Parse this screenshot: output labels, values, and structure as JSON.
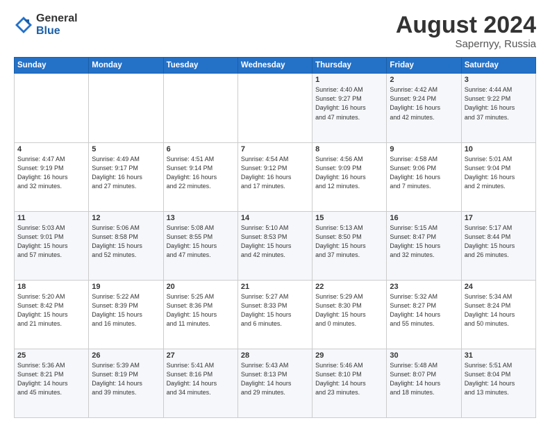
{
  "header": {
    "logo_general": "General",
    "logo_blue": "Blue",
    "title_month": "August 2024",
    "title_location": "Sapernyy, Russia"
  },
  "days_of_week": [
    "Sunday",
    "Monday",
    "Tuesday",
    "Wednesday",
    "Thursday",
    "Friday",
    "Saturday"
  ],
  "weeks": [
    [
      {
        "day": "",
        "info": ""
      },
      {
        "day": "",
        "info": ""
      },
      {
        "day": "",
        "info": ""
      },
      {
        "day": "",
        "info": ""
      },
      {
        "day": "1",
        "info": "Sunrise: 4:40 AM\nSunset: 9:27 PM\nDaylight: 16 hours\nand 47 minutes."
      },
      {
        "day": "2",
        "info": "Sunrise: 4:42 AM\nSunset: 9:24 PM\nDaylight: 16 hours\nand 42 minutes."
      },
      {
        "day": "3",
        "info": "Sunrise: 4:44 AM\nSunset: 9:22 PM\nDaylight: 16 hours\nand 37 minutes."
      }
    ],
    [
      {
        "day": "4",
        "info": "Sunrise: 4:47 AM\nSunset: 9:19 PM\nDaylight: 16 hours\nand 32 minutes."
      },
      {
        "day": "5",
        "info": "Sunrise: 4:49 AM\nSunset: 9:17 PM\nDaylight: 16 hours\nand 27 minutes."
      },
      {
        "day": "6",
        "info": "Sunrise: 4:51 AM\nSunset: 9:14 PM\nDaylight: 16 hours\nand 22 minutes."
      },
      {
        "day": "7",
        "info": "Sunrise: 4:54 AM\nSunset: 9:12 PM\nDaylight: 16 hours\nand 17 minutes."
      },
      {
        "day": "8",
        "info": "Sunrise: 4:56 AM\nSunset: 9:09 PM\nDaylight: 16 hours\nand 12 minutes."
      },
      {
        "day": "9",
        "info": "Sunrise: 4:58 AM\nSunset: 9:06 PM\nDaylight: 16 hours\nand 7 minutes."
      },
      {
        "day": "10",
        "info": "Sunrise: 5:01 AM\nSunset: 9:04 PM\nDaylight: 16 hours\nand 2 minutes."
      }
    ],
    [
      {
        "day": "11",
        "info": "Sunrise: 5:03 AM\nSunset: 9:01 PM\nDaylight: 15 hours\nand 57 minutes."
      },
      {
        "day": "12",
        "info": "Sunrise: 5:06 AM\nSunset: 8:58 PM\nDaylight: 15 hours\nand 52 minutes."
      },
      {
        "day": "13",
        "info": "Sunrise: 5:08 AM\nSunset: 8:55 PM\nDaylight: 15 hours\nand 47 minutes."
      },
      {
        "day": "14",
        "info": "Sunrise: 5:10 AM\nSunset: 8:53 PM\nDaylight: 15 hours\nand 42 minutes."
      },
      {
        "day": "15",
        "info": "Sunrise: 5:13 AM\nSunset: 8:50 PM\nDaylight: 15 hours\nand 37 minutes."
      },
      {
        "day": "16",
        "info": "Sunrise: 5:15 AM\nSunset: 8:47 PM\nDaylight: 15 hours\nand 32 minutes."
      },
      {
        "day": "17",
        "info": "Sunrise: 5:17 AM\nSunset: 8:44 PM\nDaylight: 15 hours\nand 26 minutes."
      }
    ],
    [
      {
        "day": "18",
        "info": "Sunrise: 5:20 AM\nSunset: 8:42 PM\nDaylight: 15 hours\nand 21 minutes."
      },
      {
        "day": "19",
        "info": "Sunrise: 5:22 AM\nSunset: 8:39 PM\nDaylight: 15 hours\nand 16 minutes."
      },
      {
        "day": "20",
        "info": "Sunrise: 5:25 AM\nSunset: 8:36 PM\nDaylight: 15 hours\nand 11 minutes."
      },
      {
        "day": "21",
        "info": "Sunrise: 5:27 AM\nSunset: 8:33 PM\nDaylight: 15 hours\nand 6 minutes."
      },
      {
        "day": "22",
        "info": "Sunrise: 5:29 AM\nSunset: 8:30 PM\nDaylight: 15 hours\nand 0 minutes."
      },
      {
        "day": "23",
        "info": "Sunrise: 5:32 AM\nSunset: 8:27 PM\nDaylight: 14 hours\nand 55 minutes."
      },
      {
        "day": "24",
        "info": "Sunrise: 5:34 AM\nSunset: 8:24 PM\nDaylight: 14 hours\nand 50 minutes."
      }
    ],
    [
      {
        "day": "25",
        "info": "Sunrise: 5:36 AM\nSunset: 8:21 PM\nDaylight: 14 hours\nand 45 minutes."
      },
      {
        "day": "26",
        "info": "Sunrise: 5:39 AM\nSunset: 8:19 PM\nDaylight: 14 hours\nand 39 minutes."
      },
      {
        "day": "27",
        "info": "Sunrise: 5:41 AM\nSunset: 8:16 PM\nDaylight: 14 hours\nand 34 minutes."
      },
      {
        "day": "28",
        "info": "Sunrise: 5:43 AM\nSunset: 8:13 PM\nDaylight: 14 hours\nand 29 minutes."
      },
      {
        "day": "29",
        "info": "Sunrise: 5:46 AM\nSunset: 8:10 PM\nDaylight: 14 hours\nand 23 minutes."
      },
      {
        "day": "30",
        "info": "Sunrise: 5:48 AM\nSunset: 8:07 PM\nDaylight: 14 hours\nand 18 minutes."
      },
      {
        "day": "31",
        "info": "Sunrise: 5:51 AM\nSunset: 8:04 PM\nDaylight: 14 hours\nand 13 minutes."
      }
    ]
  ]
}
